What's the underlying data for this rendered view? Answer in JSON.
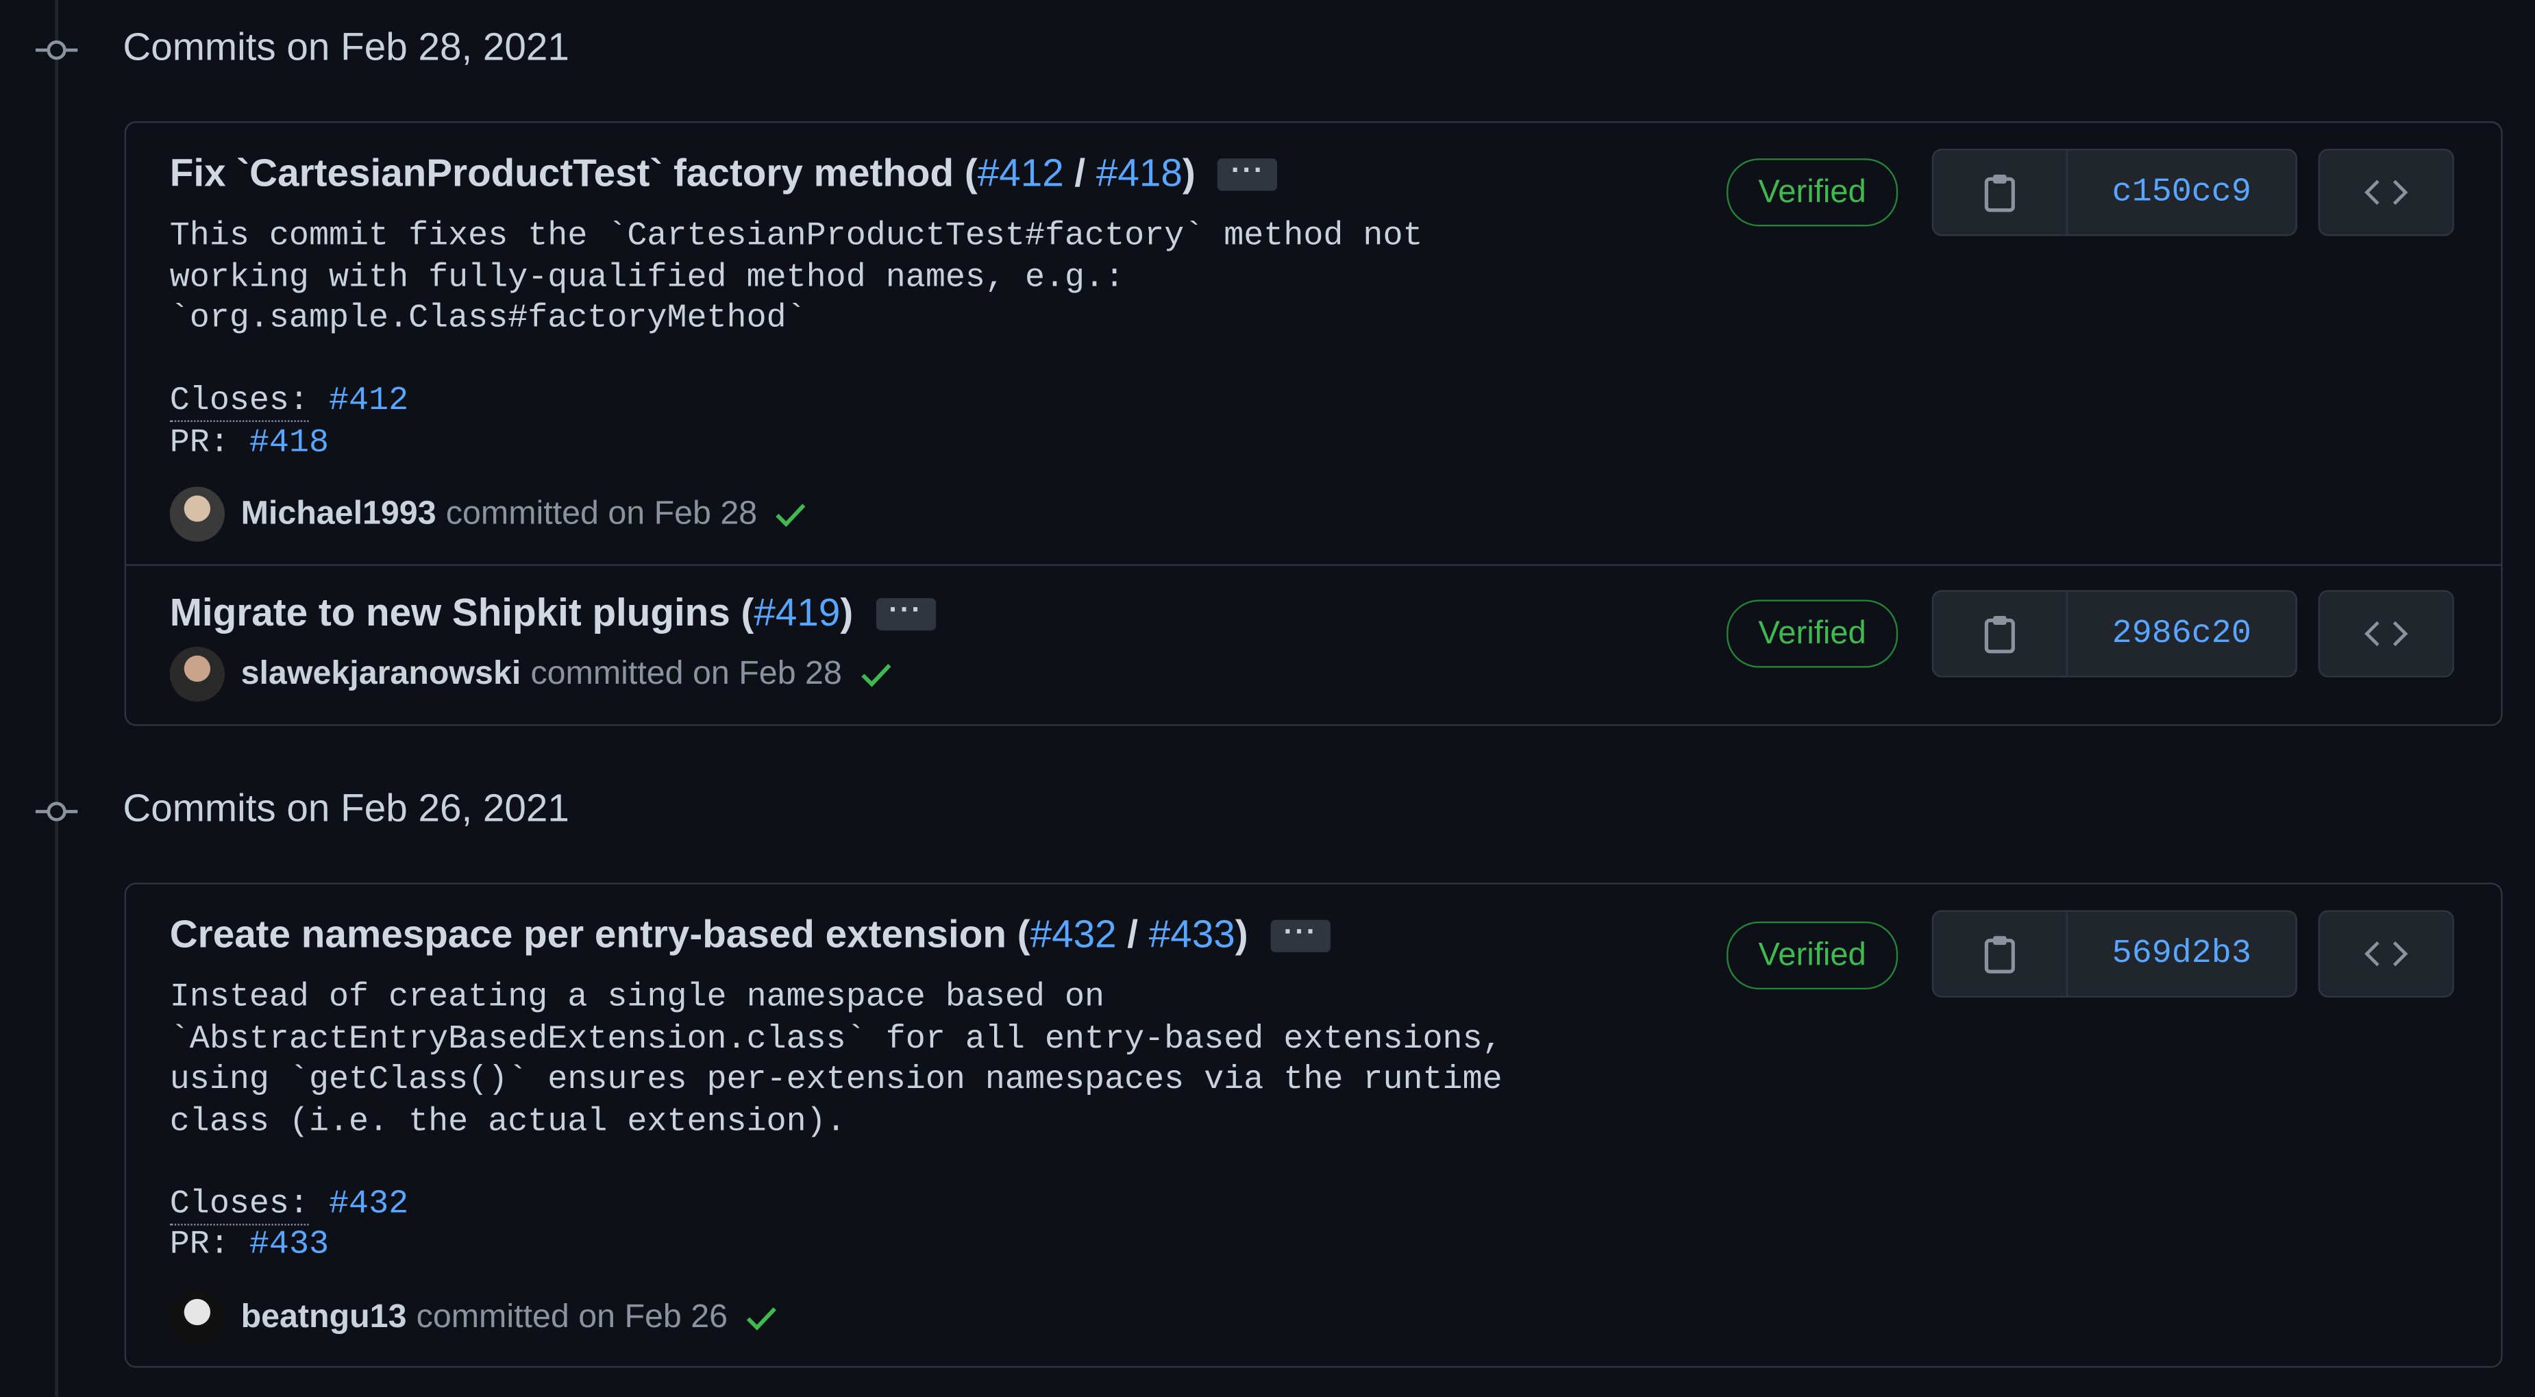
{
  "groups": [
    {
      "title": "Commits on Feb 28, 2021",
      "commits": [
        {
          "title_prefix": "Fix `CartesianProductTest` factory method (",
          "links": [
            "#412",
            "#418"
          ],
          "separator": " / ",
          "title_suffix": ")",
          "ellipsis": "···",
          "body_lines": [
            "This commit fixes the `CartesianProductTest#factory` method not",
            "working with fully-qualified method names, e.g.:",
            "`org.sample.Class#factoryMethod`"
          ],
          "closes_label": "Closes:",
          "closes_link": "#412",
          "pr_label": "PR:",
          "pr_link": "#418",
          "author": "Michael1993",
          "committed": "committed on Feb 28",
          "verified": "Verified",
          "sha": "c150cc9"
        },
        {
          "title_prefix": "Migrate to new Shipkit plugins (",
          "links": [
            "#419"
          ],
          "title_suffix": ")",
          "ellipsis": "···",
          "author": "slawekjaranowski",
          "committed": "committed on Feb 28",
          "verified": "Verified",
          "sha": "2986c20"
        }
      ]
    },
    {
      "title": "Commits on Feb 26, 2021",
      "commits": [
        {
          "title_prefix": "Create namespace per entry-based extension (",
          "links": [
            "#432",
            "#433"
          ],
          "separator": " / ",
          "title_suffix": ")",
          "ellipsis": "···",
          "body_lines": [
            "Instead of creating a single namespace based on",
            "`AbstractEntryBasedExtension.class` for all entry-based extensions,",
            "using `getClass()` ensures per-extension namespaces via the runtime",
            "class (i.e. the actual extension)."
          ],
          "closes_label": "Closes:",
          "closes_link": "#432",
          "pr_label": "PR:",
          "pr_link": "#433",
          "author": "beatngu13",
          "committed": "committed on Feb 26",
          "verified": "Verified",
          "sha": "569d2b3"
        }
      ]
    }
  ],
  "icons": {
    "timeline": "git-commit-icon",
    "copy": "clipboard-icon",
    "browse": "code-icon",
    "status": "check-icon"
  },
  "colors": {
    "background": "#0d1117",
    "link": "#58a6ff",
    "verified": "#3fb950",
    "border": "#30363d"
  }
}
